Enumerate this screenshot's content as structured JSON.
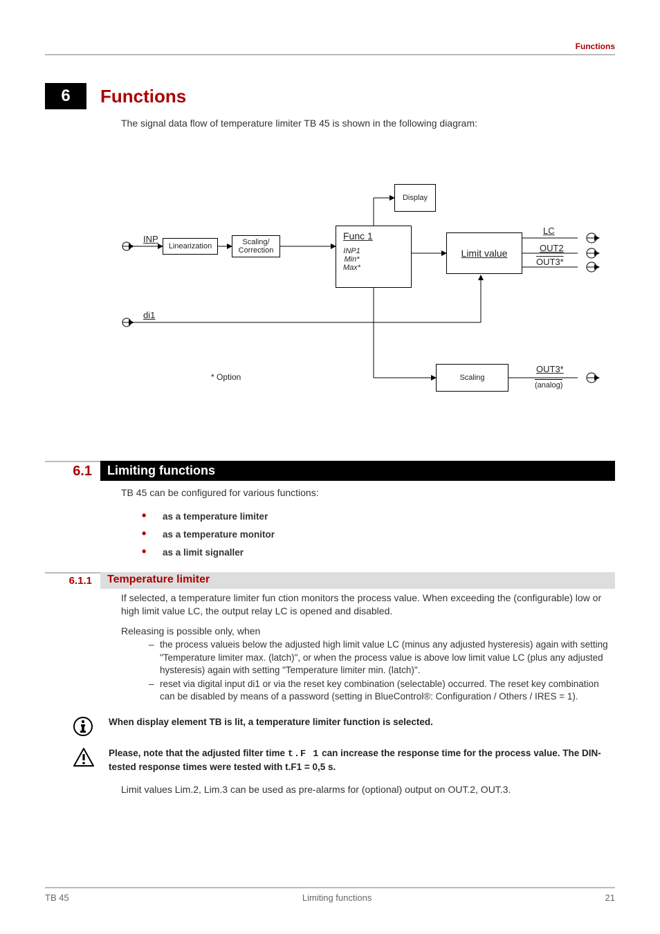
{
  "header": {
    "section_label": "Functions"
  },
  "chapter": {
    "number": "6",
    "title": "Functions"
  },
  "intro": "The signal data flow of temperature limiter TB 45 is shown in the following diagram:",
  "diagram": {
    "inp_label": "INP",
    "linearization": "Linearization",
    "scaling_correction": "Scaling/\nCorrection",
    "display": "Display",
    "func1": "Func 1",
    "func1_sub": "INP1\nMin*\nMax*",
    "limit_value": "Limit value",
    "di1": "di1",
    "option_note": "* Option",
    "scaling": "Scaling",
    "out_lc": "LC",
    "out2": "OUT2",
    "out3": "OUT3*",
    "out3_analog": "OUT3*",
    "analog_note": "(analog)"
  },
  "section61": {
    "number": "6.1",
    "title": "Limiting functions",
    "intro": "TB 45 can be configured for various functions:",
    "bullets": [
      "as a temperature limiter",
      "as a temperature monitor",
      "as a limit signaller"
    ]
  },
  "section611": {
    "number": "6.1.1",
    "title": "Temperature limiter",
    "para1": "If selected, a temperature limiter fun ction monitors the process value. When exceeding the (configurable) low or high limit value LC, the output relay LC is opened and disabled.",
    "para2_intro": "Releasing is possible only, when",
    "dash1": "the process valueis below the adjusted high limit value LC (minus any adjusted hysteresis) again with setting \"Temperature limiter max. (latch)\", or when the process value is above low limit value LC (plus any adjusted hysteresis) again with setting \"Temperature limiter min. (latch)\".",
    "dash2": "reset via digital input di1 or via the reset key combination (selectable) occurred. The reset key combination can be disabled by means of a password (setting in BlueControl®:  Configuration / Others / IRES = 1).",
    "info_note": "When display element TB is lit, a temperature limiter function is selected.",
    "warn_note_a": "Please, note that the adjusted filter time ",
    "warn_seg": "t.F 1",
    "warn_note_b": " can increase the response time for the process value. The DIN-tested response times were tested with t.F1 = 0,5 s.",
    "tail": "Limit values Lim.2, Lim.3 can be used as pre-alarms for (optional) output on OUT.2, OUT.3."
  },
  "footer": {
    "left": "TB 45",
    "center": "Limiting functions",
    "right": "21"
  }
}
